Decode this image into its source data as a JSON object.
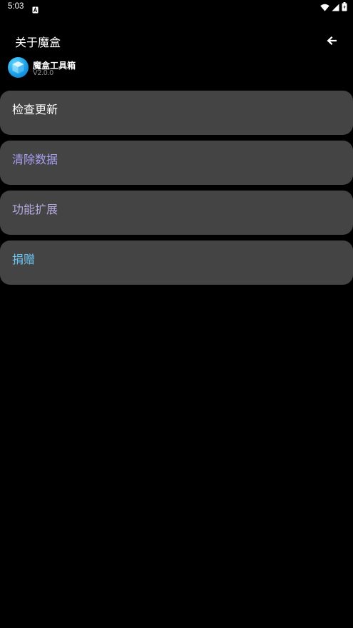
{
  "status_bar": {
    "time": "5:03",
    "notification_icon": "font-a-icon",
    "right_icons": [
      "wifi-icon",
      "signal-icon",
      "battery-icon"
    ]
  },
  "header": {
    "title": "关于魔盒",
    "back_icon": "arrow-left-icon"
  },
  "app": {
    "name": "魔盒工具箱",
    "version": "V2.0.0",
    "logo_icon": "cube-logo-icon"
  },
  "menu": {
    "items": [
      {
        "label": "检查更新",
        "color": "#ffffff"
      },
      {
        "label": "清除数据",
        "color": "#a79ff0"
      },
      {
        "label": "功能扩展",
        "color": "#b5a9dd"
      },
      {
        "label": "捐赠",
        "color": "#6cc6f5"
      }
    ]
  },
  "colors": {
    "background": "#000000",
    "card": "#444444",
    "secondary_text": "#9a9a9a"
  }
}
